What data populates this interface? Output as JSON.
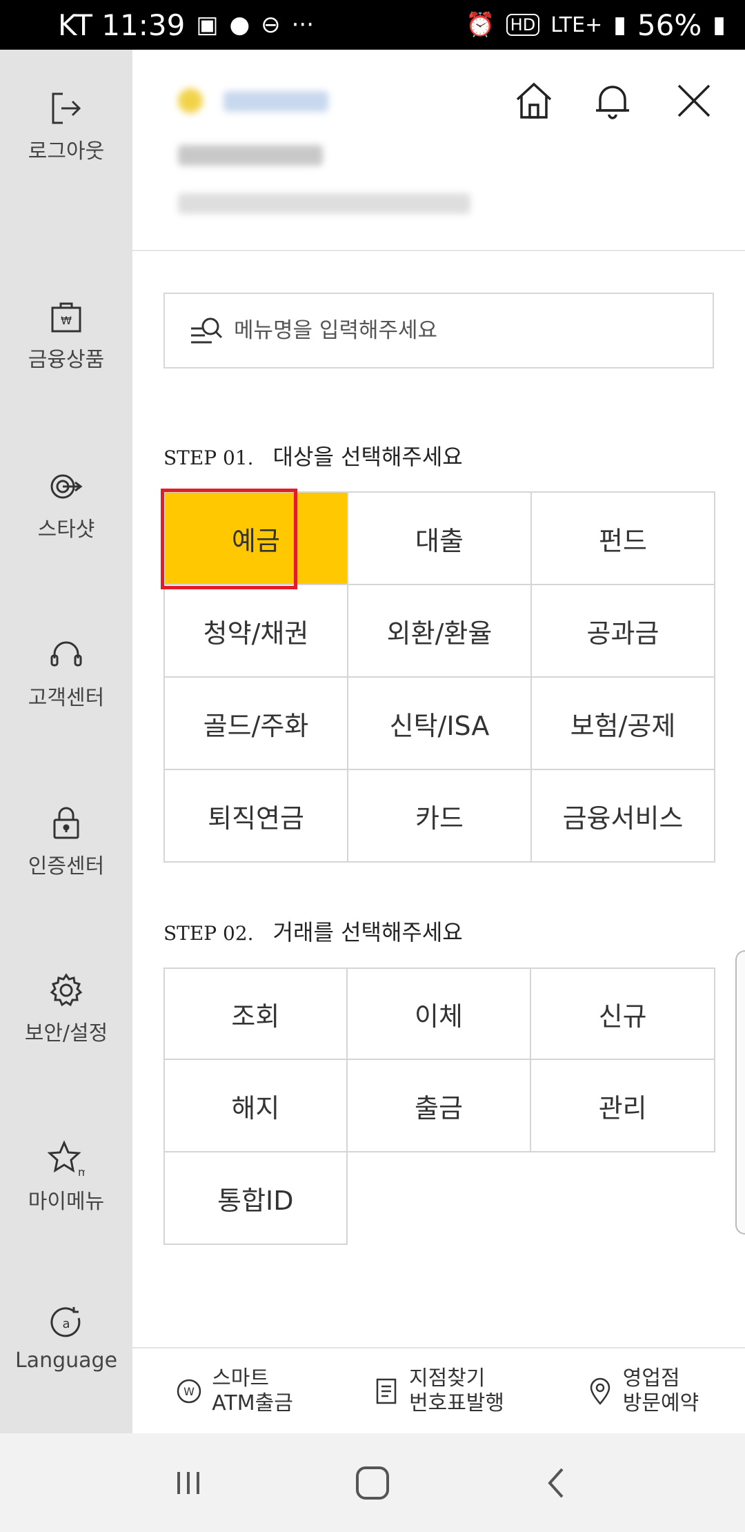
{
  "status_bar": {
    "carrier_time": "KT 11:39",
    "network": "LTE+",
    "battery": "56%"
  },
  "sidebar": {
    "items": [
      {
        "label": "로그아웃",
        "icon": "logout-icon"
      },
      {
        "label": "금융상품",
        "icon": "financial-product-icon"
      },
      {
        "label": "스타샷",
        "icon": "starshot-icon"
      },
      {
        "label": "고객센터",
        "icon": "headset-icon"
      },
      {
        "label": "인증센터",
        "icon": "lock-icon"
      },
      {
        "label": "보안/설정",
        "icon": "gear-icon"
      },
      {
        "label": "마이메뉴",
        "icon": "star-icon"
      },
      {
        "label": "Language",
        "icon": "language-icon"
      }
    ]
  },
  "header": {
    "icons": [
      "home-icon",
      "bell-icon",
      "close-icon"
    ]
  },
  "search": {
    "placeholder": "메뉴명을 입력해주세요"
  },
  "step1": {
    "number": "STEP 01.",
    "title": "대상을 선택해주세요",
    "selected": "예금",
    "items": [
      "예금",
      "대출",
      "펀드",
      "청약/채권",
      "외환/환율",
      "공과금",
      "골드/주화",
      "신탁/ISA",
      "보험/공제",
      "퇴직연금",
      "카드",
      "금융서비스"
    ]
  },
  "step2": {
    "number": "STEP 02.",
    "title": "거래를 선택해주세요",
    "items": [
      "조회",
      "이체",
      "신규",
      "해지",
      "출금",
      "관리",
      "통합ID"
    ]
  },
  "quick_menu": [
    {
      "line1": "스마트",
      "line2": "ATM출금",
      "icon": "won-coin-icon"
    },
    {
      "line1": "지점찾기",
      "line2": "번호표발행",
      "icon": "document-icon"
    },
    {
      "line1": "영업점",
      "line2": "방문예약",
      "icon": "location-pin-icon"
    }
  ],
  "colors": {
    "selected_bg": "#ffc800",
    "highlight_border": "#e01e28",
    "sidebar_bg": "#e3e3e3"
  }
}
